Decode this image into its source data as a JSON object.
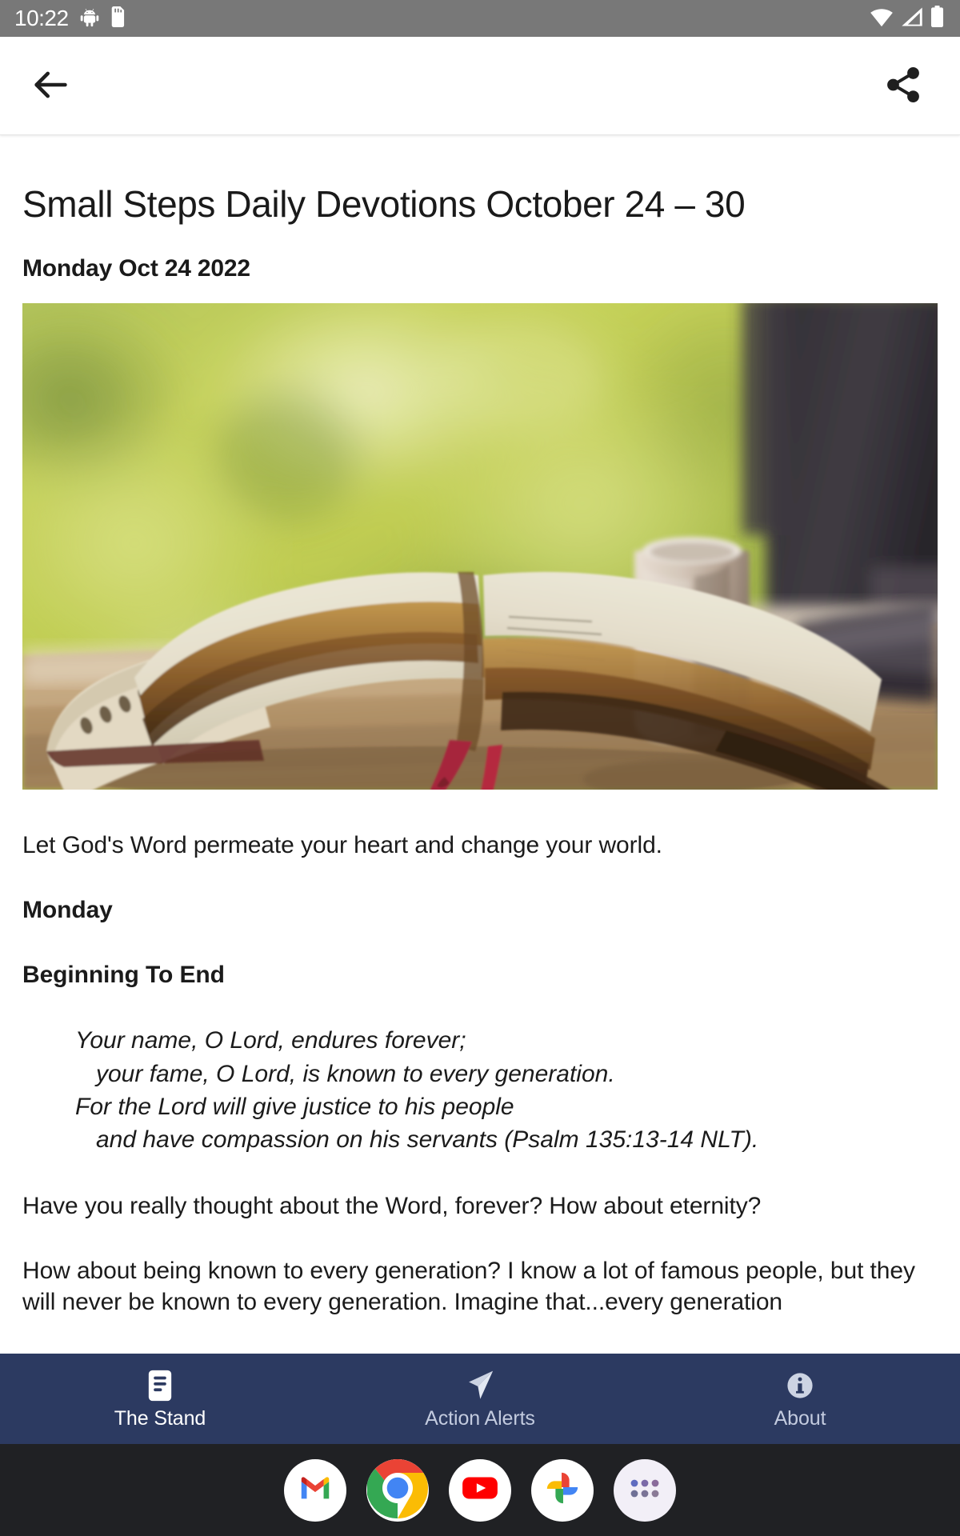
{
  "status_bar": {
    "time": "10:22",
    "left_icons": [
      "android-debug-icon",
      "sd-card-icon"
    ],
    "right_icons": [
      "wifi-icon",
      "cellular-signal-icon",
      "battery-icon"
    ],
    "background_color": "#787878"
  },
  "app_bar": {
    "back_label": "back-arrow",
    "share_label": "share",
    "icons": [
      "back-arrow-icon",
      "share-icon"
    ]
  },
  "article": {
    "title": "Small Steps Daily Devotions October 24 – 30",
    "date": "Monday Oct 24 2022",
    "hero_image_alt": "Open Bible on a wooden table beside a tall mug, blurred green foliage through a window",
    "intro": "Let God's Word permeate your heart and change your world.",
    "day_heading": "Monday",
    "section_heading": "Beginning To End",
    "scripture": {
      "line1": "Your name, O Lord, endures forever;",
      "line2": "your fame, O Lord, is known to every generation.",
      "line3": "For the Lord will give justice to his people",
      "line4": "and have compassion on his servants (Psalm 135:13-14 NLT)."
    },
    "paragraph1": "Have you really thought about the Word, forever? How about eternity?",
    "paragraph2": "How about being known to every generation? I know a lot of famous people, but they will never be known to every generation. Imagine that...every generation"
  },
  "bottom_nav": {
    "background_color": "#2c3a61",
    "active_color": "#ffffff",
    "inactive_color": "#c3cbdf",
    "items": [
      {
        "label": "The Stand",
        "icon": "article-document-icon",
        "active": true
      },
      {
        "label": "Action Alerts",
        "icon": "send-paper-plane-icon",
        "active": false
      },
      {
        "label": "About",
        "icon": "info-circle-icon",
        "active": false
      }
    ]
  },
  "dock": {
    "background_color": "#202124",
    "apps": [
      {
        "name": "Gmail",
        "icon": "gmail-icon"
      },
      {
        "name": "Chrome",
        "icon": "chrome-icon"
      },
      {
        "name": "YouTube",
        "icon": "youtube-icon"
      },
      {
        "name": "Google Photos",
        "icon": "google-photos-icon"
      },
      {
        "name": "App Drawer",
        "icon": "app-drawer-icon"
      }
    ]
  }
}
